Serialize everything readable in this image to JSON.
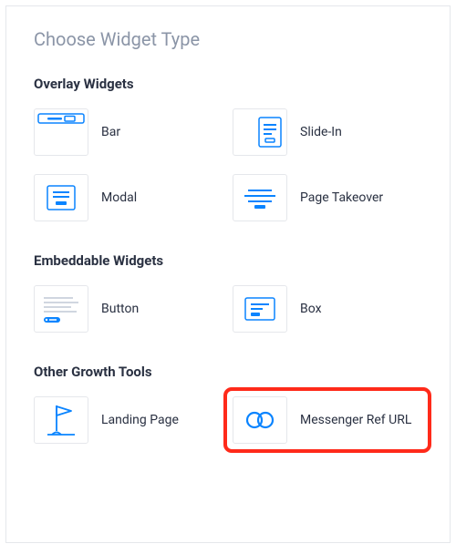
{
  "title": "Choose Widget Type",
  "sections": {
    "overlay": {
      "title": "Overlay Widgets",
      "items": {
        "bar": "Bar",
        "slidein": "Slide-In",
        "modal": "Modal",
        "takeover": "Page Takeover"
      }
    },
    "embeddable": {
      "title": "Embeddable Widgets",
      "items": {
        "button": "Button",
        "box": "Box"
      }
    },
    "other": {
      "title": "Other Growth Tools",
      "items": {
        "landing": "Landing Page",
        "refurl": "Messenger Ref URL"
      }
    }
  }
}
